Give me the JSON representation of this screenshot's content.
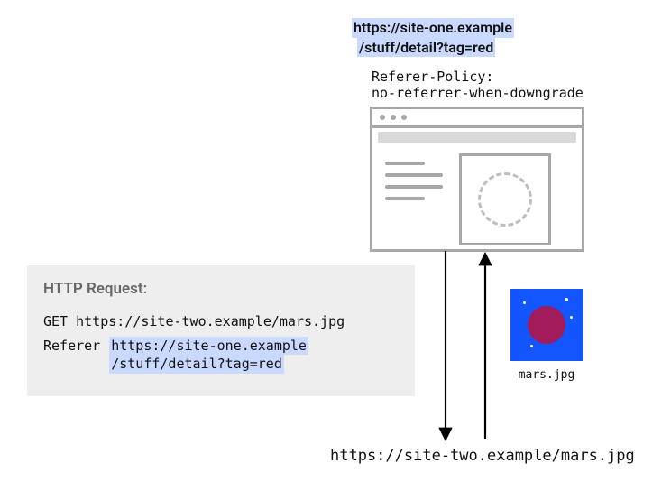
{
  "top_url_line1": "https://site-one.example",
  "top_url_line2": "/stuff/detail?tag=red",
  "policy_label": "Referer-Policy:",
  "policy_value": "no-referrer-when-downgrade",
  "http_title": "HTTP Request:",
  "http_method_line": "GET https://site-two.example/mars.jpg",
  "http_header_key": "Referer",
  "http_header_val_line1": "https://site-one.example",
  "http_header_val_line2": "/stuff/detail?tag=red",
  "mars_filename": "mars.jpg",
  "bottom_url": "https://site-two.example/mars.jpg"
}
